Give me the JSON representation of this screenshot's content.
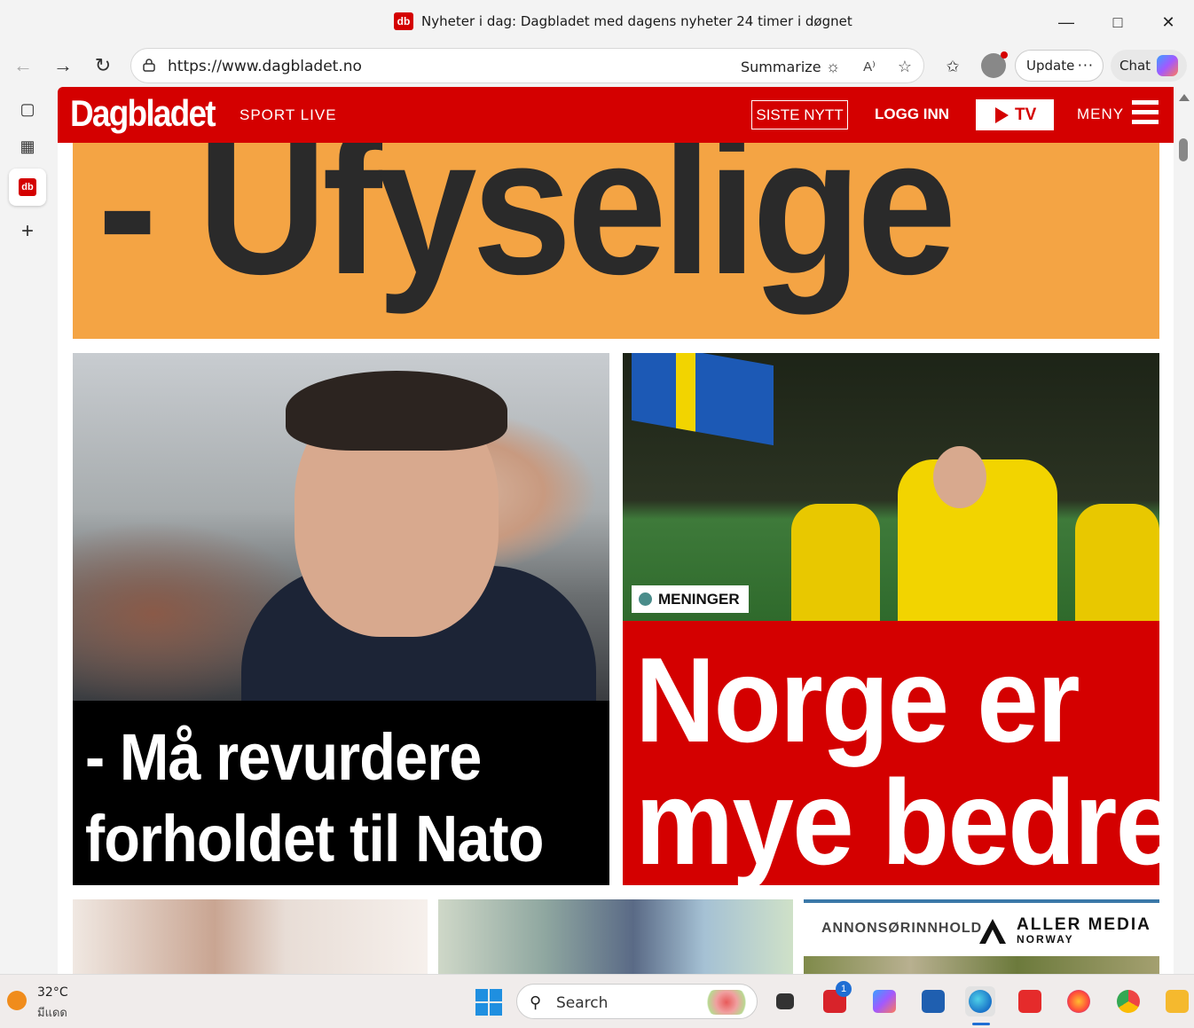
{
  "window": {
    "title": "Nyheter i dag: Dagbladet med dagens nyheter 24 timer i døgnet",
    "favicon_text": "db",
    "controls": [
      "minimize-icon",
      "maximize-icon",
      "close-icon"
    ]
  },
  "toolbar": {
    "url": "https://www.dagbladet.no",
    "summarize_label": "Summarize",
    "update_label": "Update",
    "update_more": "···",
    "chat_label": "Chat"
  },
  "sidebar": {
    "items": [
      "tab-actions-icon",
      "tab-grid-icon",
      "dagbladet-tab",
      "add-tab-icon"
    ],
    "db_label": "db"
  },
  "site": {
    "logo": "Dagbladet",
    "sport_live": "SPORT LIVE",
    "siste_nytt": "SISTE NYTT",
    "logg_inn": "LOGG INN",
    "tv": "TV",
    "meny": "MENY",
    "brand_color": "#d40000"
  },
  "articles": {
    "top_banner": "- Ufyselige",
    "left_headline_line1": "- Må revurdere",
    "left_headline_line2": "forholdet til Nato",
    "right_tag": "MENINGER",
    "right_headline_line1": "Norge er",
    "right_headline_line2": "mye bedre",
    "ad_label": "ANNONSØRINNHOLD",
    "ad_brand": "ALLER MEDIA",
    "ad_brand_sub": "NORWAY"
  },
  "taskbar": {
    "temperature": "32°C",
    "condition": "มีแดด",
    "search_placeholder": "Search",
    "notification_count": "1"
  }
}
